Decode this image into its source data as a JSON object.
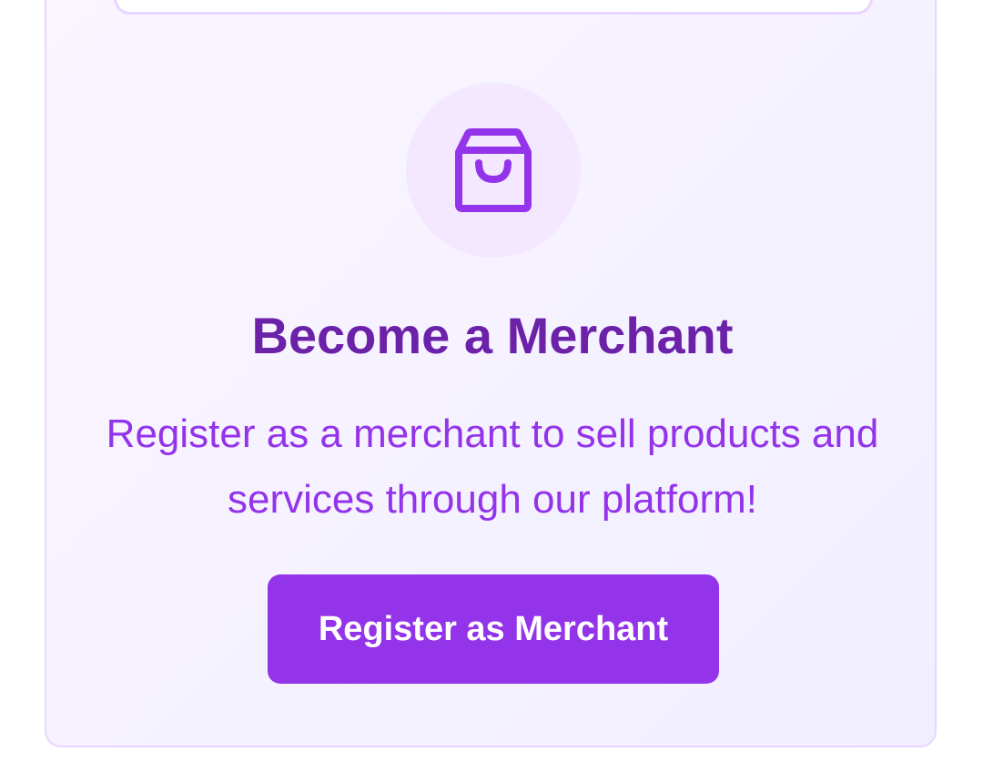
{
  "merchant_card": {
    "icon": "shopping-bag-icon",
    "title": "Become a Merchant",
    "description": "Register as a merchant to sell products and services through our platform!",
    "button_label": "Register as Merchant"
  },
  "colors": {
    "accent": "#9333ea",
    "title": "#6b21a8",
    "icon_bg": "#f3e8ff",
    "border": "#e9d5ff"
  }
}
